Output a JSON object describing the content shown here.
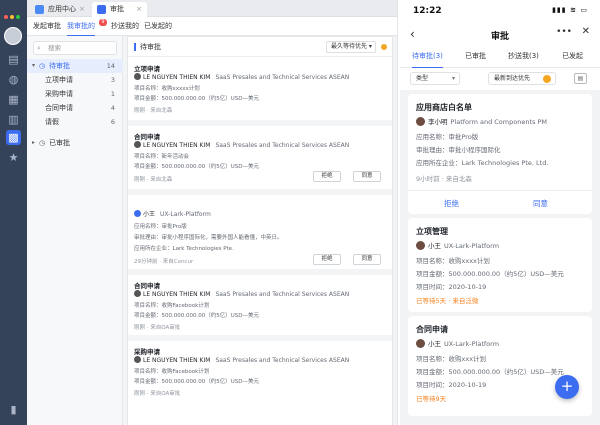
{
  "window": {
    "tabs": [
      {
        "label": "应用中心"
      },
      {
        "label": "审批"
      }
    ]
  },
  "subnav": {
    "items": [
      {
        "label": "发起审批"
      },
      {
        "label": "我审批的"
      },
      {
        "label": "抄送我的"
      },
      {
        "label": "已发起的"
      }
    ],
    "badge": "9"
  },
  "sidebar": {
    "search_placeholder": "搜索",
    "pending": {
      "label": "待审批",
      "count": "14"
    },
    "items": [
      {
        "label": "立项申请",
        "count": "3"
      },
      {
        "label": "采购申请",
        "count": "1"
      },
      {
        "label": "合同申请",
        "count": "4"
      },
      {
        "label": "请假",
        "count": "6"
      }
    ],
    "done": {
      "label": "已审批"
    }
  },
  "main": {
    "title": "待审批",
    "sort_label": "最久等待优先",
    "cards": [
      {
        "title": "立项申请",
        "user": "LE NGUYEN THIEN KIM",
        "org": "SaaS Presales and Technical Services ASEAN",
        "fields": [
          "项目名称：收购xxxxx计划",
          "项目金额：500.000.000.00（约5亿）USD—美元"
        ],
        "meta": "刚刚 · 来自北森"
      },
      {
        "title": "合同申请",
        "user": "LE NGUYEN THIEN KIM",
        "org": "SaaS Presales and Technical Services ASEAN",
        "fields": [
          "项目名称：新年活动会",
          "项目金额：500.000.000.00（约5亿）USD—美元"
        ],
        "meta": "刚刚 · 来自北森"
      },
      {
        "title": "",
        "user": "小王",
        "org": "UX-Lark-Platform",
        "fields": [
          "应用名称：审批Pro版",
          "审批理由：审批小程序国际化，需要外国人能看懂，中英日。",
          "应用所在企业：Lark Technologies Pte."
        ],
        "meta": "29分钟前 · 来自Concur"
      },
      {
        "title": "合同申请",
        "user": "LE NGUYEN THIEN KIM",
        "org": "SaaS Presales and Technical Services ASEAN",
        "fields": [
          "项目名称：收购Facebook计划",
          "项目金额：500.000.000.00（约5亿）USD—美元"
        ],
        "meta": "刚刚 · 来自OA审批"
      },
      {
        "title": "采购申请",
        "user": "LE NGUYEN THIEN KIM",
        "org": "SaaS Presales and Technical Services ASEAN",
        "fields": [
          "项目名称：收购Facebook计划",
          "项目金额：500.000.000.00（约5亿）USD—美元"
        ],
        "meta": "刚刚 · 来自OA审批"
      }
    ],
    "reject_label": "拒绝",
    "approve_label": "同意"
  },
  "mobile": {
    "time": "12:22",
    "signal": "▮▮▮ ≋ ▭",
    "title": "审批",
    "tabs": [
      {
        "label": "待审批(3)"
      },
      {
        "label": "已审批"
      },
      {
        "label": "抄送我(3)"
      },
      {
        "label": "已发起"
      }
    ],
    "filter_type": "类型",
    "filter_sort": "最新到达优先",
    "cards": [
      {
        "title": "应用商店白名单",
        "user": "李小明",
        "org": "Platform and Components PM",
        "fields": [
          "应用名称：审批Pro版",
          "审批理由：审批小程序国际化",
          "应用所在企业：Lark Technologies Pte. Ltd."
        ],
        "meta": "9小时前 · 来自北森"
      },
      {
        "title": "立项管理",
        "user": "小王",
        "org": "UX-Lark-Platform",
        "fields": [
          "项目名称：收购xxxx计划",
          "项目金额：500.000.000.00（约5亿）USD—美元",
          "项目时间：2020-10-19"
        ],
        "meta": "已等待5天 · 来自泛微"
      },
      {
        "title": "合同申请",
        "user": "小王",
        "org": "UX-Lark-Platform",
        "fields": [
          "项目名称：收购xxx计划",
          "项目金额：500.000.000.00（约5亿）USD—美元",
          "项目时间：2020-10-19"
        ],
        "meta": "已等待9天"
      }
    ],
    "reject_label": "拒绝",
    "approve_label": "同意",
    "fab": "+"
  },
  "colors": {
    "accent": "#3c6df0",
    "rail": "#34425a",
    "warning": "#f5a623",
    "danger": "#f04f4f"
  }
}
